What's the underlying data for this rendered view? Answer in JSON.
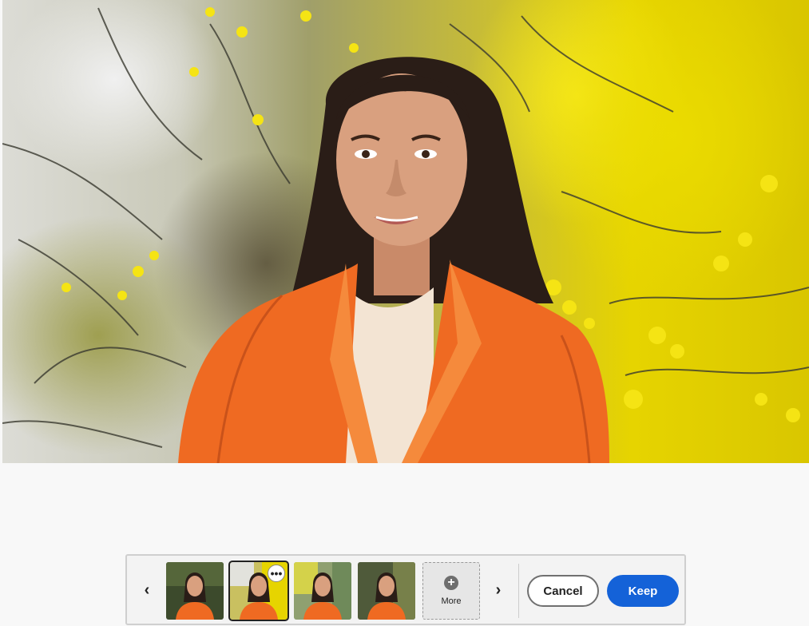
{
  "colors": {
    "primary_button": "#1462d8",
    "jacket": "#ef6a22",
    "foliage": "#e6d400"
  },
  "toolbar": {
    "prev_icon": "chevron-left-icon",
    "next_icon": "chevron-right-icon",
    "thumbnails": [
      {
        "variant": "dark-green-background"
      },
      {
        "variant": "yellow-blossom-background",
        "selected": true,
        "options_icon": "more-horizontal-icon"
      },
      {
        "variant": "green-yellow-background"
      },
      {
        "variant": "forest-background"
      }
    ],
    "more_label": "More",
    "more_icon": "plus-circle-icon",
    "cancel_label": "Cancel",
    "keep_label": "Keep"
  }
}
